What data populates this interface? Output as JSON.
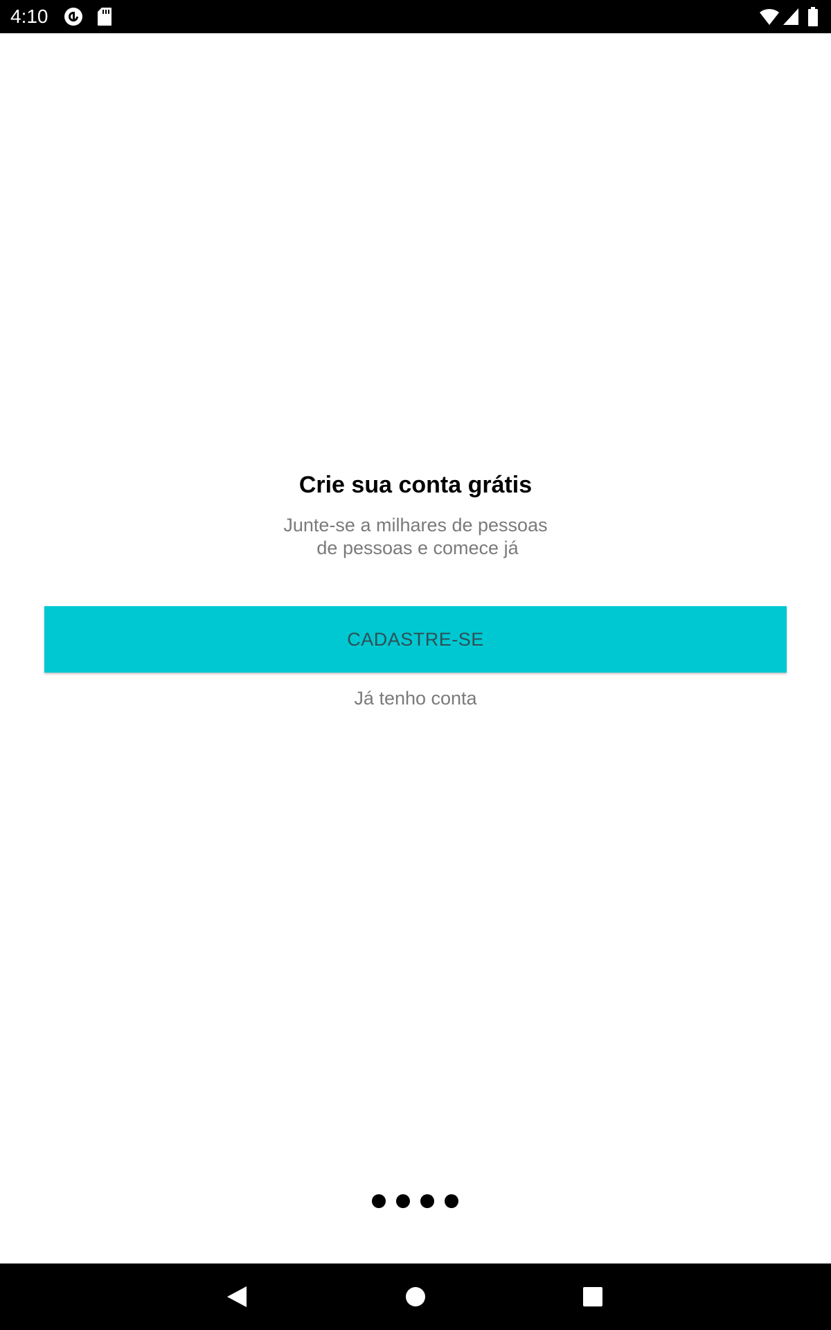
{
  "status_bar": {
    "time": "4:10",
    "icons": [
      "pocket-casts-icon",
      "sd-card-icon",
      "wifi-icon",
      "signal-icon",
      "battery-icon"
    ]
  },
  "main": {
    "title": "Crie sua conta grátis",
    "subtitle_lines": [
      "Junte-se a milhares de pessoas",
      "de pessoas e comece já"
    ],
    "signup_label": "CADASTRE-SE",
    "login_label": "Já tenho conta",
    "pager_dots": 4
  },
  "nav_bar": {
    "icons": [
      "back-icon",
      "home-icon",
      "recents-icon"
    ]
  },
  "colors": {
    "accent": "#00c8d2",
    "button_text": "#2f4f55",
    "secondary_text": "#7a7a7a",
    "bars": "#000000"
  }
}
